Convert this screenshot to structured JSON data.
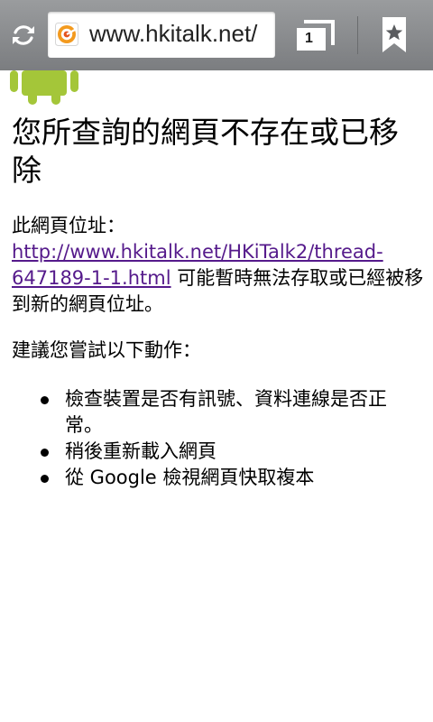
{
  "browser": {
    "url": "www.hkitalk.net/",
    "tab_count": "1",
    "icons": {
      "reload": "reload-icon",
      "favicon": "site-favicon-icon",
      "tabs": "tabs-icon",
      "bookmark": "bookmark-star-icon"
    }
  },
  "page": {
    "title": "您所查詢的網頁不存在或已移除",
    "address_prefix": "此網頁位址：",
    "link_url": "http://www.hkitalk.net/HKiTalk2/thread-647189-1-1.html",
    "address_suffix": " 可能暫時無法存取或已經被移到新的網頁位址。",
    "suggest_heading": "建議您嘗試以下動作：",
    "suggestions": [
      "檢查裝置是否有訊號、資料連線是否正常。",
      "稍後重新載入網頁",
      "從 Google 檢視網頁快取複本"
    ]
  },
  "colors": {
    "toolbar": "#8a8c8f",
    "link": "#551a8b",
    "android_green": "#a4c639"
  }
}
